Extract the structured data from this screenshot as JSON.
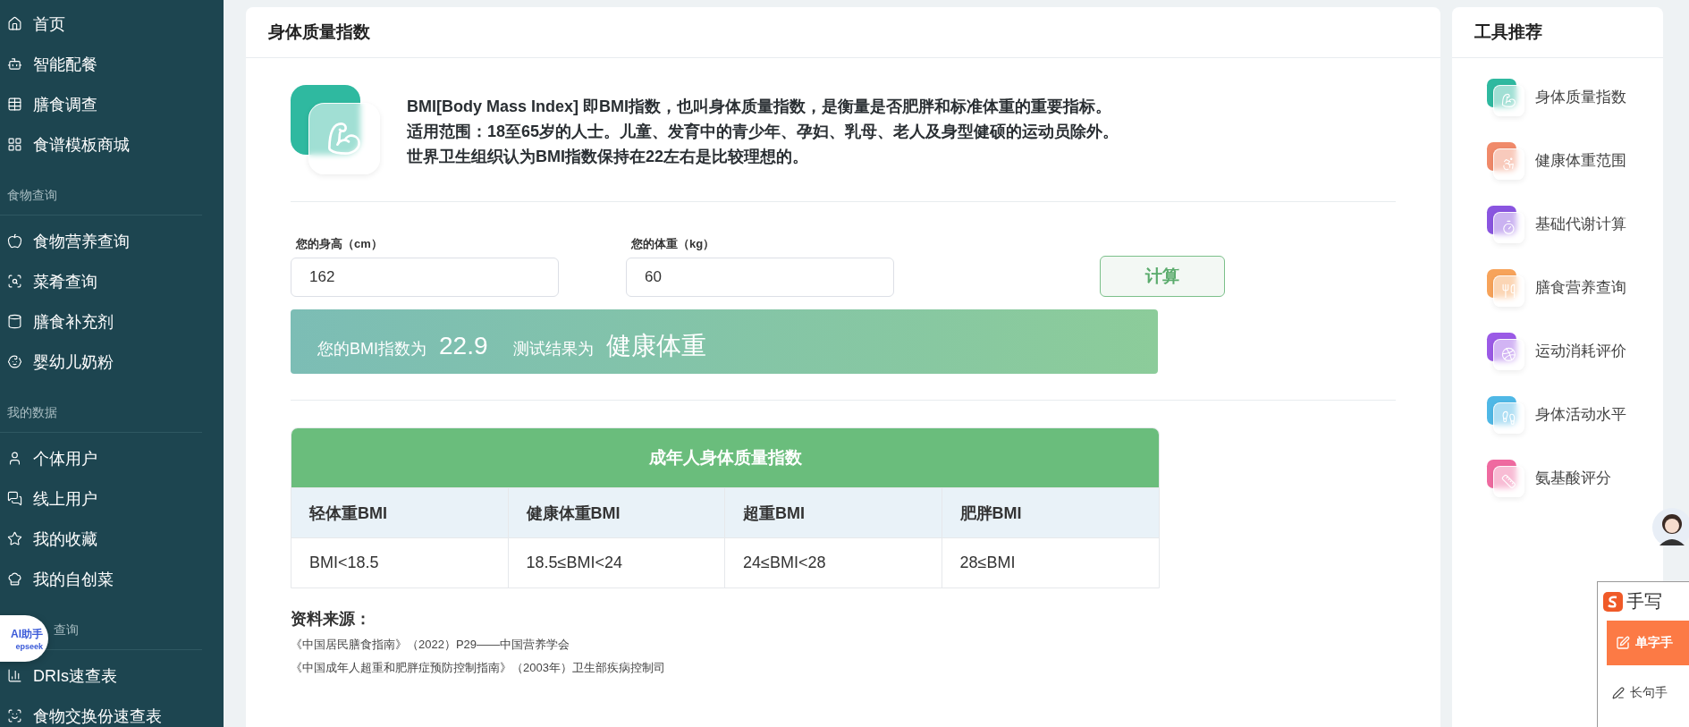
{
  "sidebar": {
    "sections": [
      {
        "items": [
          {
            "label": "首页"
          },
          {
            "label": "智能配餐"
          },
          {
            "label": "膳食调查"
          },
          {
            "label": "食谱模板商城"
          }
        ]
      },
      {
        "header": "食物查询",
        "items": [
          {
            "label": "食物营养查询"
          },
          {
            "label": "菜肴查询"
          },
          {
            "label": "膳食补充剂"
          },
          {
            "label": "婴幼儿奶粉"
          }
        ]
      },
      {
        "header": "我的数据",
        "items": [
          {
            "label": "个体用户"
          },
          {
            "label": "线上用户"
          },
          {
            "label": "我的收藏"
          },
          {
            "label": "我的自创菜"
          }
        ]
      },
      {
        "header": "查询",
        "items": [
          {
            "label": "DRIs速查表"
          },
          {
            "label": "食物交换份速查表"
          }
        ]
      }
    ]
  },
  "assistant_bubble": {
    "title": "AI助手",
    "subtitle": "epseek"
  },
  "main": {
    "title": "身体质量指数",
    "intro": [
      "BMI[Body Mass Index] 即BMI指数，也叫身体质量指数，是衡量是否肥胖和标准体重的重要指标。",
      "适用范围：18至65岁的人士。儿童、发育中的青少年、孕妇、乳母、老人及身型健硕的运动员除外。",
      "世界卫生组织认为BMI指数保持在22左右是比较理想的。"
    ],
    "height_field": {
      "label": "您的身高（cm）",
      "value": "162"
    },
    "weight_field": {
      "label": "您的体重（kg）",
      "value": "60"
    },
    "calc_button": "计算",
    "result": {
      "bmi_label": "您的BMI指数为",
      "bmi": "22.9",
      "result_label": "测试结果为",
      "result": "健康体重"
    },
    "table": {
      "title": "成年人身体质量指数",
      "columns": [
        "轻体重BMI",
        "健康体重BMI",
        "超重BMI",
        "肥胖BMI"
      ],
      "rows": [
        [
          "BMI<18.5",
          "18.5≤BMI<24",
          "24≤BMI<28",
          "28≤BMI"
        ]
      ]
    },
    "sources": {
      "title": "资料来源：",
      "lines": [
        "《中国居民膳食指南》（2022）P29——中国营养学会",
        "《中国成年人超重和肥胖症预防控制指南》（2003年）卫生部疾病控制司"
      ]
    }
  },
  "tools": {
    "title": "工具推荐",
    "items": [
      {
        "label": "身体质量指数",
        "color": "#2fb9a0"
      },
      {
        "label": "健康体重范围",
        "color": "#f08a6a"
      },
      {
        "label": "基础代谢计算",
        "color": "#8a55e0"
      },
      {
        "label": "膳食营养查询",
        "color": "#f7a35a"
      },
      {
        "label": "运动消耗评价",
        "color": "#9b5ae6"
      },
      {
        "label": "身体活动水平",
        "color": "#4fb8e6"
      },
      {
        "label": "氨基酸评分",
        "color": "#ef6aa0"
      }
    ]
  },
  "handwriting_panel": {
    "title": "手写",
    "single": "单字手",
    "long": "长句手"
  }
}
